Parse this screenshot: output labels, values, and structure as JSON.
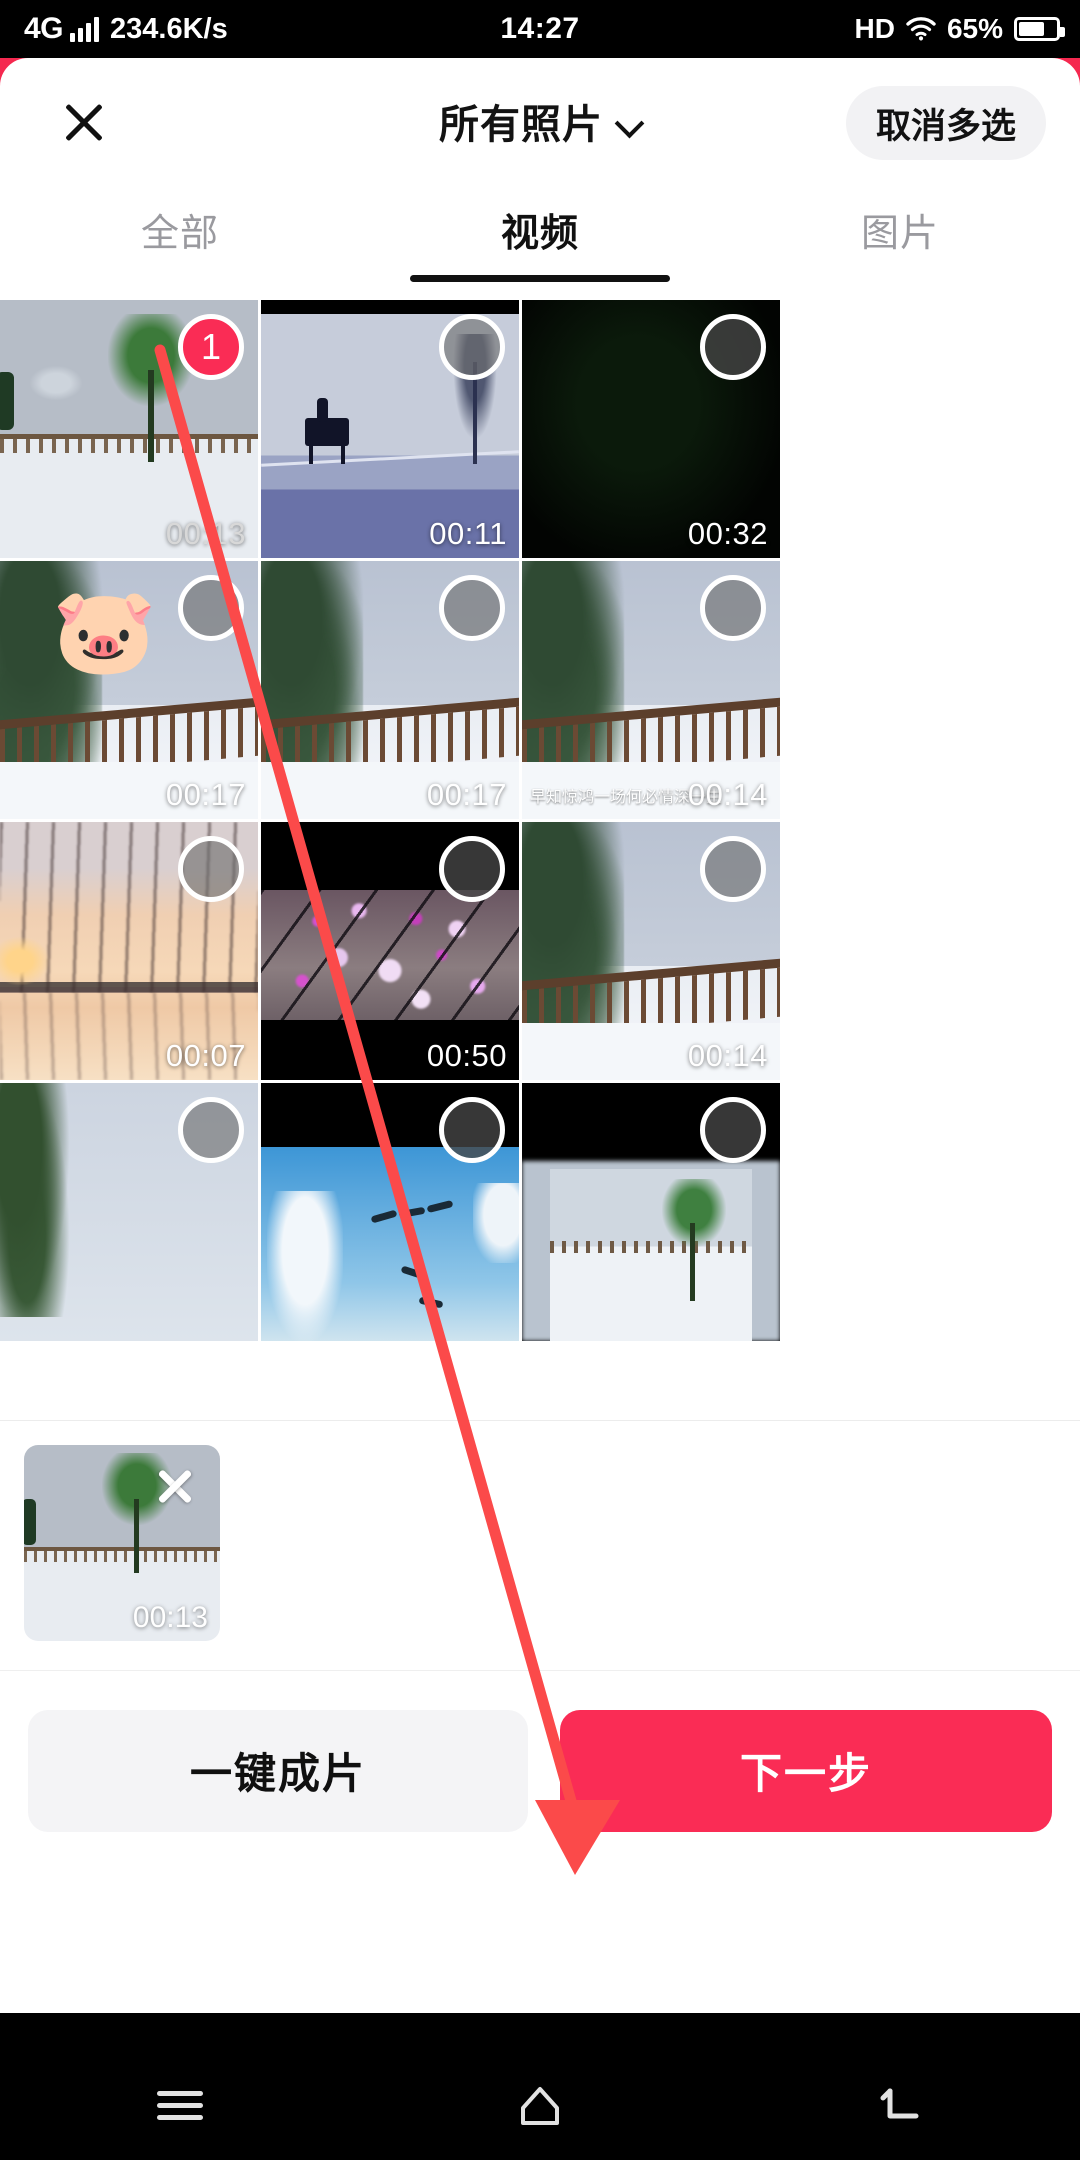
{
  "status_bar": {
    "network_type": "4G",
    "signal_icon": "signal-bars-icon",
    "net_speed": "234.6K/s",
    "clock": "14:27",
    "hd_label": "HD",
    "wifi_icon": "wifi-icon",
    "battery_percent": "65%",
    "battery_icon": "battery-icon"
  },
  "header": {
    "close_icon": "close-icon",
    "album_title": "所有照片",
    "album_chevron_icon": "chevron-down-icon",
    "multiselect_button": "取消多选"
  },
  "tabs": [
    {
      "label": "全部",
      "active": false
    },
    {
      "label": "视频",
      "active": true
    },
    {
      "label": "图片",
      "active": false
    }
  ],
  "grid": {
    "items": [
      {
        "duration": "00:13",
        "selected": true,
        "badge": "1",
        "scene": "snow-park-tree",
        "watermark": ""
      },
      {
        "duration": "00:11",
        "selected": false,
        "badge": "",
        "scene": "horse-rider-snow",
        "watermark": ""
      },
      {
        "duration": "00:32",
        "selected": false,
        "badge": "",
        "scene": "dark-night",
        "watermark": ""
      },
      {
        "duration": "00:17",
        "selected": false,
        "badge": "",
        "scene": "balcony-snow-pig",
        "watermark": "",
        "emoji": "🐷"
      },
      {
        "duration": "00:17",
        "selected": false,
        "badge": "",
        "scene": "balcony-snow",
        "watermark": ""
      },
      {
        "duration": "00:14",
        "selected": false,
        "badge": "",
        "scene": "balcony-snow",
        "watermark": "早知惊鸿一场何必情深一生"
      },
      {
        "duration": "00:07",
        "selected": false,
        "badge": "",
        "scene": "sunset-trees-water",
        "watermark": ""
      },
      {
        "duration": "00:50",
        "selected": false,
        "badge": "",
        "scene": "plum-blossom-letterbox",
        "watermark": ""
      },
      {
        "duration": "00:14",
        "selected": false,
        "badge": "",
        "scene": "balcony-snow",
        "watermark": ""
      },
      {
        "duration": "",
        "selected": false,
        "badge": "",
        "scene": "snow-tree-pale",
        "watermark": ""
      },
      {
        "duration": "",
        "selected": false,
        "badge": "",
        "scene": "birds-frost-sky",
        "watermark": ""
      },
      {
        "duration": "",
        "selected": false,
        "badge": "",
        "scene": "snow-park-blurred",
        "watermark": ""
      }
    ]
  },
  "tray": {
    "items": [
      {
        "duration": "00:13",
        "remove_icon": "close-icon",
        "scene": "snow-park-tree"
      }
    ]
  },
  "actions": {
    "secondary_label": "一键成片",
    "primary_label": "下一步"
  },
  "nav_bar": {
    "menu_icon": "menu-icon",
    "home_icon": "home-icon",
    "back_icon": "back-icon"
  },
  "annotation": {
    "arrow_color": "#fb4a4a",
    "arrow_from": "selected-thumbnail",
    "arrow_to": "next-step-button"
  },
  "colors": {
    "accent": "#fa2c55",
    "sheet_bg": "#ffffff",
    "chrome_bg": "#000000",
    "secondary_btn": "#f4f4f6"
  }
}
